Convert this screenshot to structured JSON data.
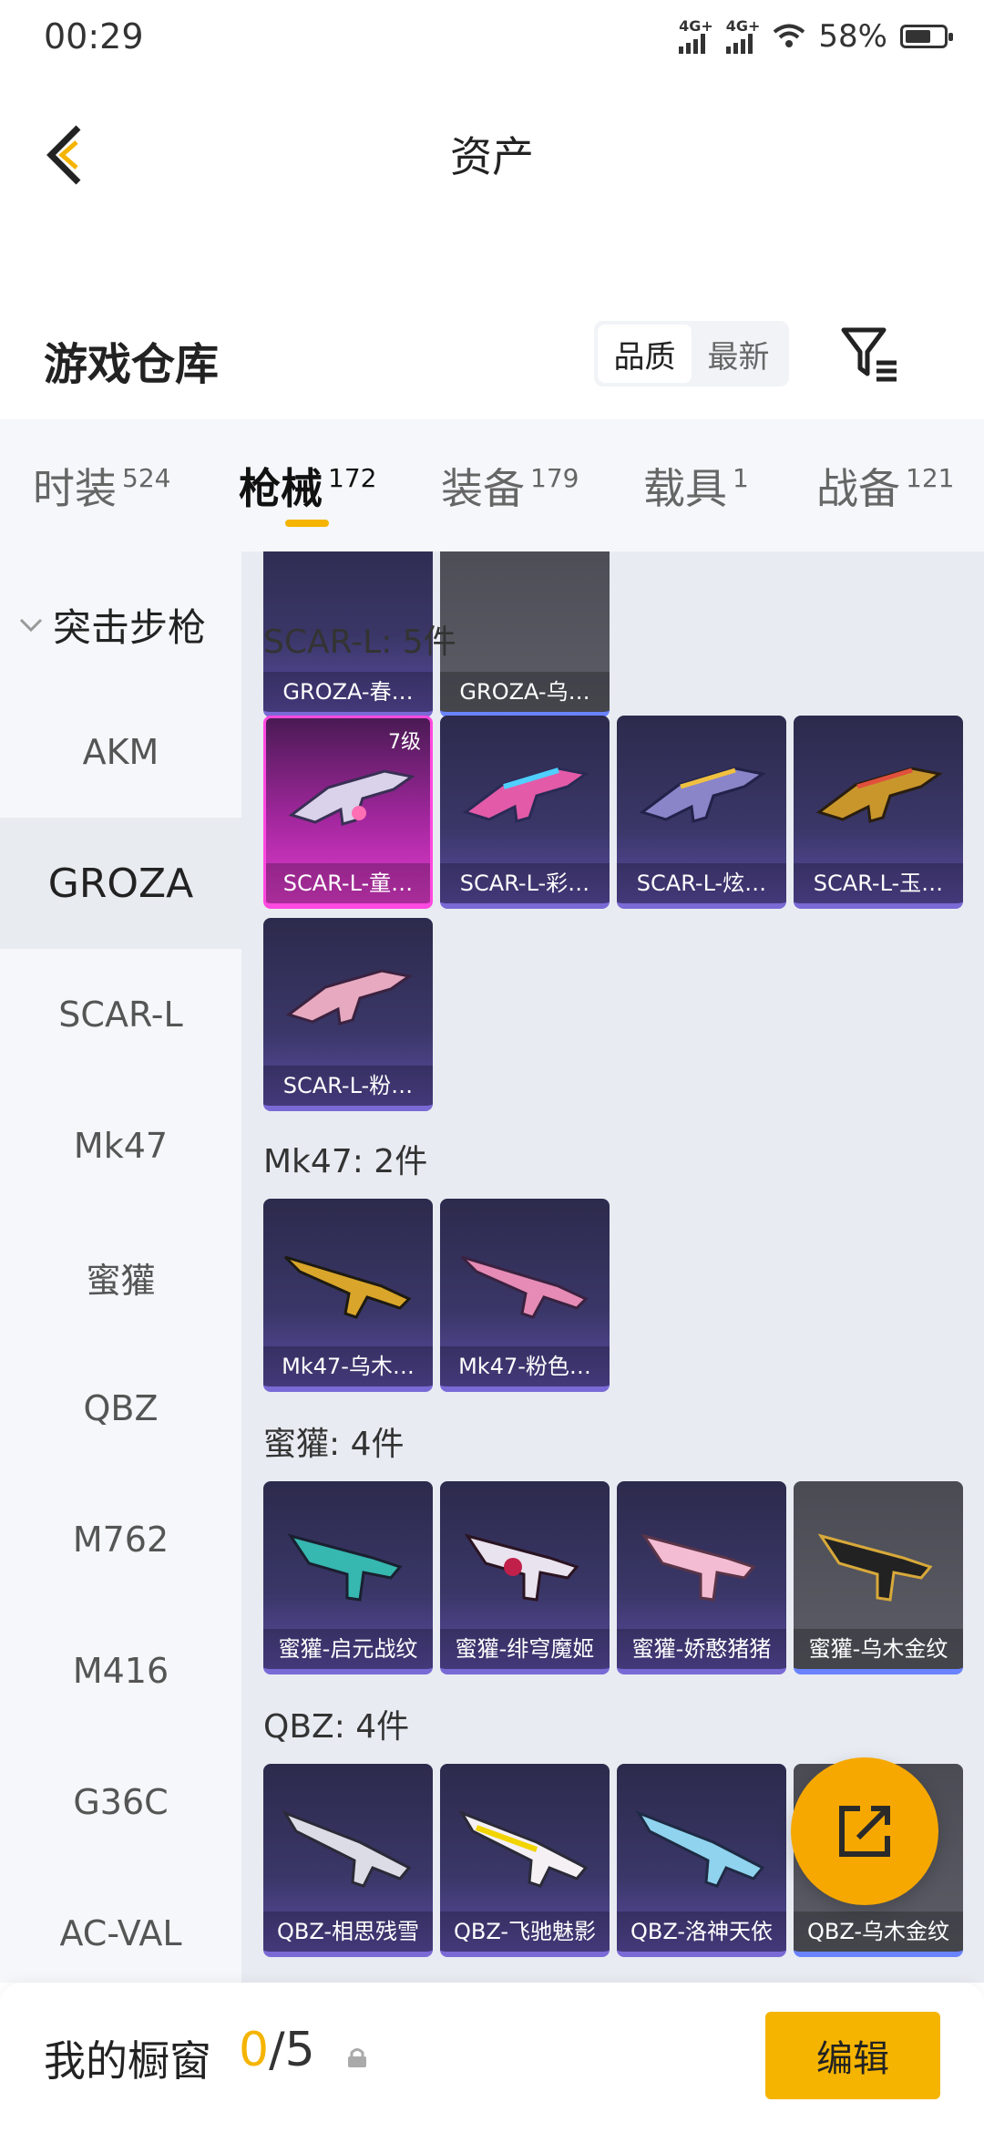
{
  "status_bar": {
    "time": "00:29",
    "network1": "4G+",
    "network2": "4G+",
    "battery": "58%",
    "battery_level": 0.58
  },
  "header": {
    "title": "资产"
  },
  "warehouse": {
    "title": "游戏仓库",
    "sort_options": [
      "品质",
      "最新"
    ],
    "sort_active": "品质"
  },
  "tabs": [
    {
      "label": "时装",
      "count": "524"
    },
    {
      "label": "枪械",
      "count": "172"
    },
    {
      "label": "装备",
      "count": "179"
    },
    {
      "label": "载具",
      "count": "1"
    },
    {
      "label": "战备",
      "count": "121"
    }
  ],
  "active_tab": "枪械",
  "sidebar": {
    "category": "突击步枪",
    "items": [
      "AKM",
      "GROZA",
      "SCAR-L",
      "Mk47",
      "蜜獾",
      "QBZ",
      "M762",
      "M416",
      "G36C",
      "AC-VAL"
    ],
    "active": "GROZA"
  },
  "sections": [
    {
      "label": "",
      "items": [
        {
          "name": "GROZA-春…"
        },
        {
          "name": "GROZA-乌…"
        }
      ]
    },
    {
      "label": "SCAR-L: 5件",
      "items": [
        {
          "name": "SCAR-L-童…",
          "level": "7级"
        },
        {
          "name": "SCAR-L-彩…"
        },
        {
          "name": "SCAR-L-炫…"
        },
        {
          "name": "SCAR-L-玉…"
        },
        {
          "name": "SCAR-L-粉…"
        }
      ]
    },
    {
      "label": "Mk47: 2件",
      "items": [
        {
          "name": "Mk47-乌木…"
        },
        {
          "name": "Mk47-粉色…"
        }
      ]
    },
    {
      "label": "蜜獾: 4件",
      "items": [
        {
          "name": "蜜獾-启元战纹"
        },
        {
          "name": "蜜獾-绯穹魔姬"
        },
        {
          "name": "蜜獾-娇憨猪猪"
        },
        {
          "name": "蜜獾-乌木金纹"
        }
      ]
    },
    {
      "label": "QBZ: 4件",
      "items": [
        {
          "name": "QBZ-相思残雪"
        },
        {
          "name": "QBZ-飞驰魅影"
        },
        {
          "name": "QBZ-洛神天依"
        },
        {
          "name": "QBZ-乌木金纹"
        }
      ]
    }
  ],
  "bottom": {
    "label": "我的橱窗",
    "count_current": "0",
    "count_total": "/5",
    "edit_label": "编辑"
  },
  "colors": {
    "accent": "#f5b400",
    "fab": "#f7a800",
    "card_dark": "#3a3768",
    "card_pink": "#e33ccf",
    "card_gray": "#5c5d66"
  },
  "icons": [
    "back-icon",
    "filter-icon",
    "chevron-down-icon",
    "share-icon",
    "lock-icon",
    "wifi-icon",
    "battery-icon"
  ]
}
